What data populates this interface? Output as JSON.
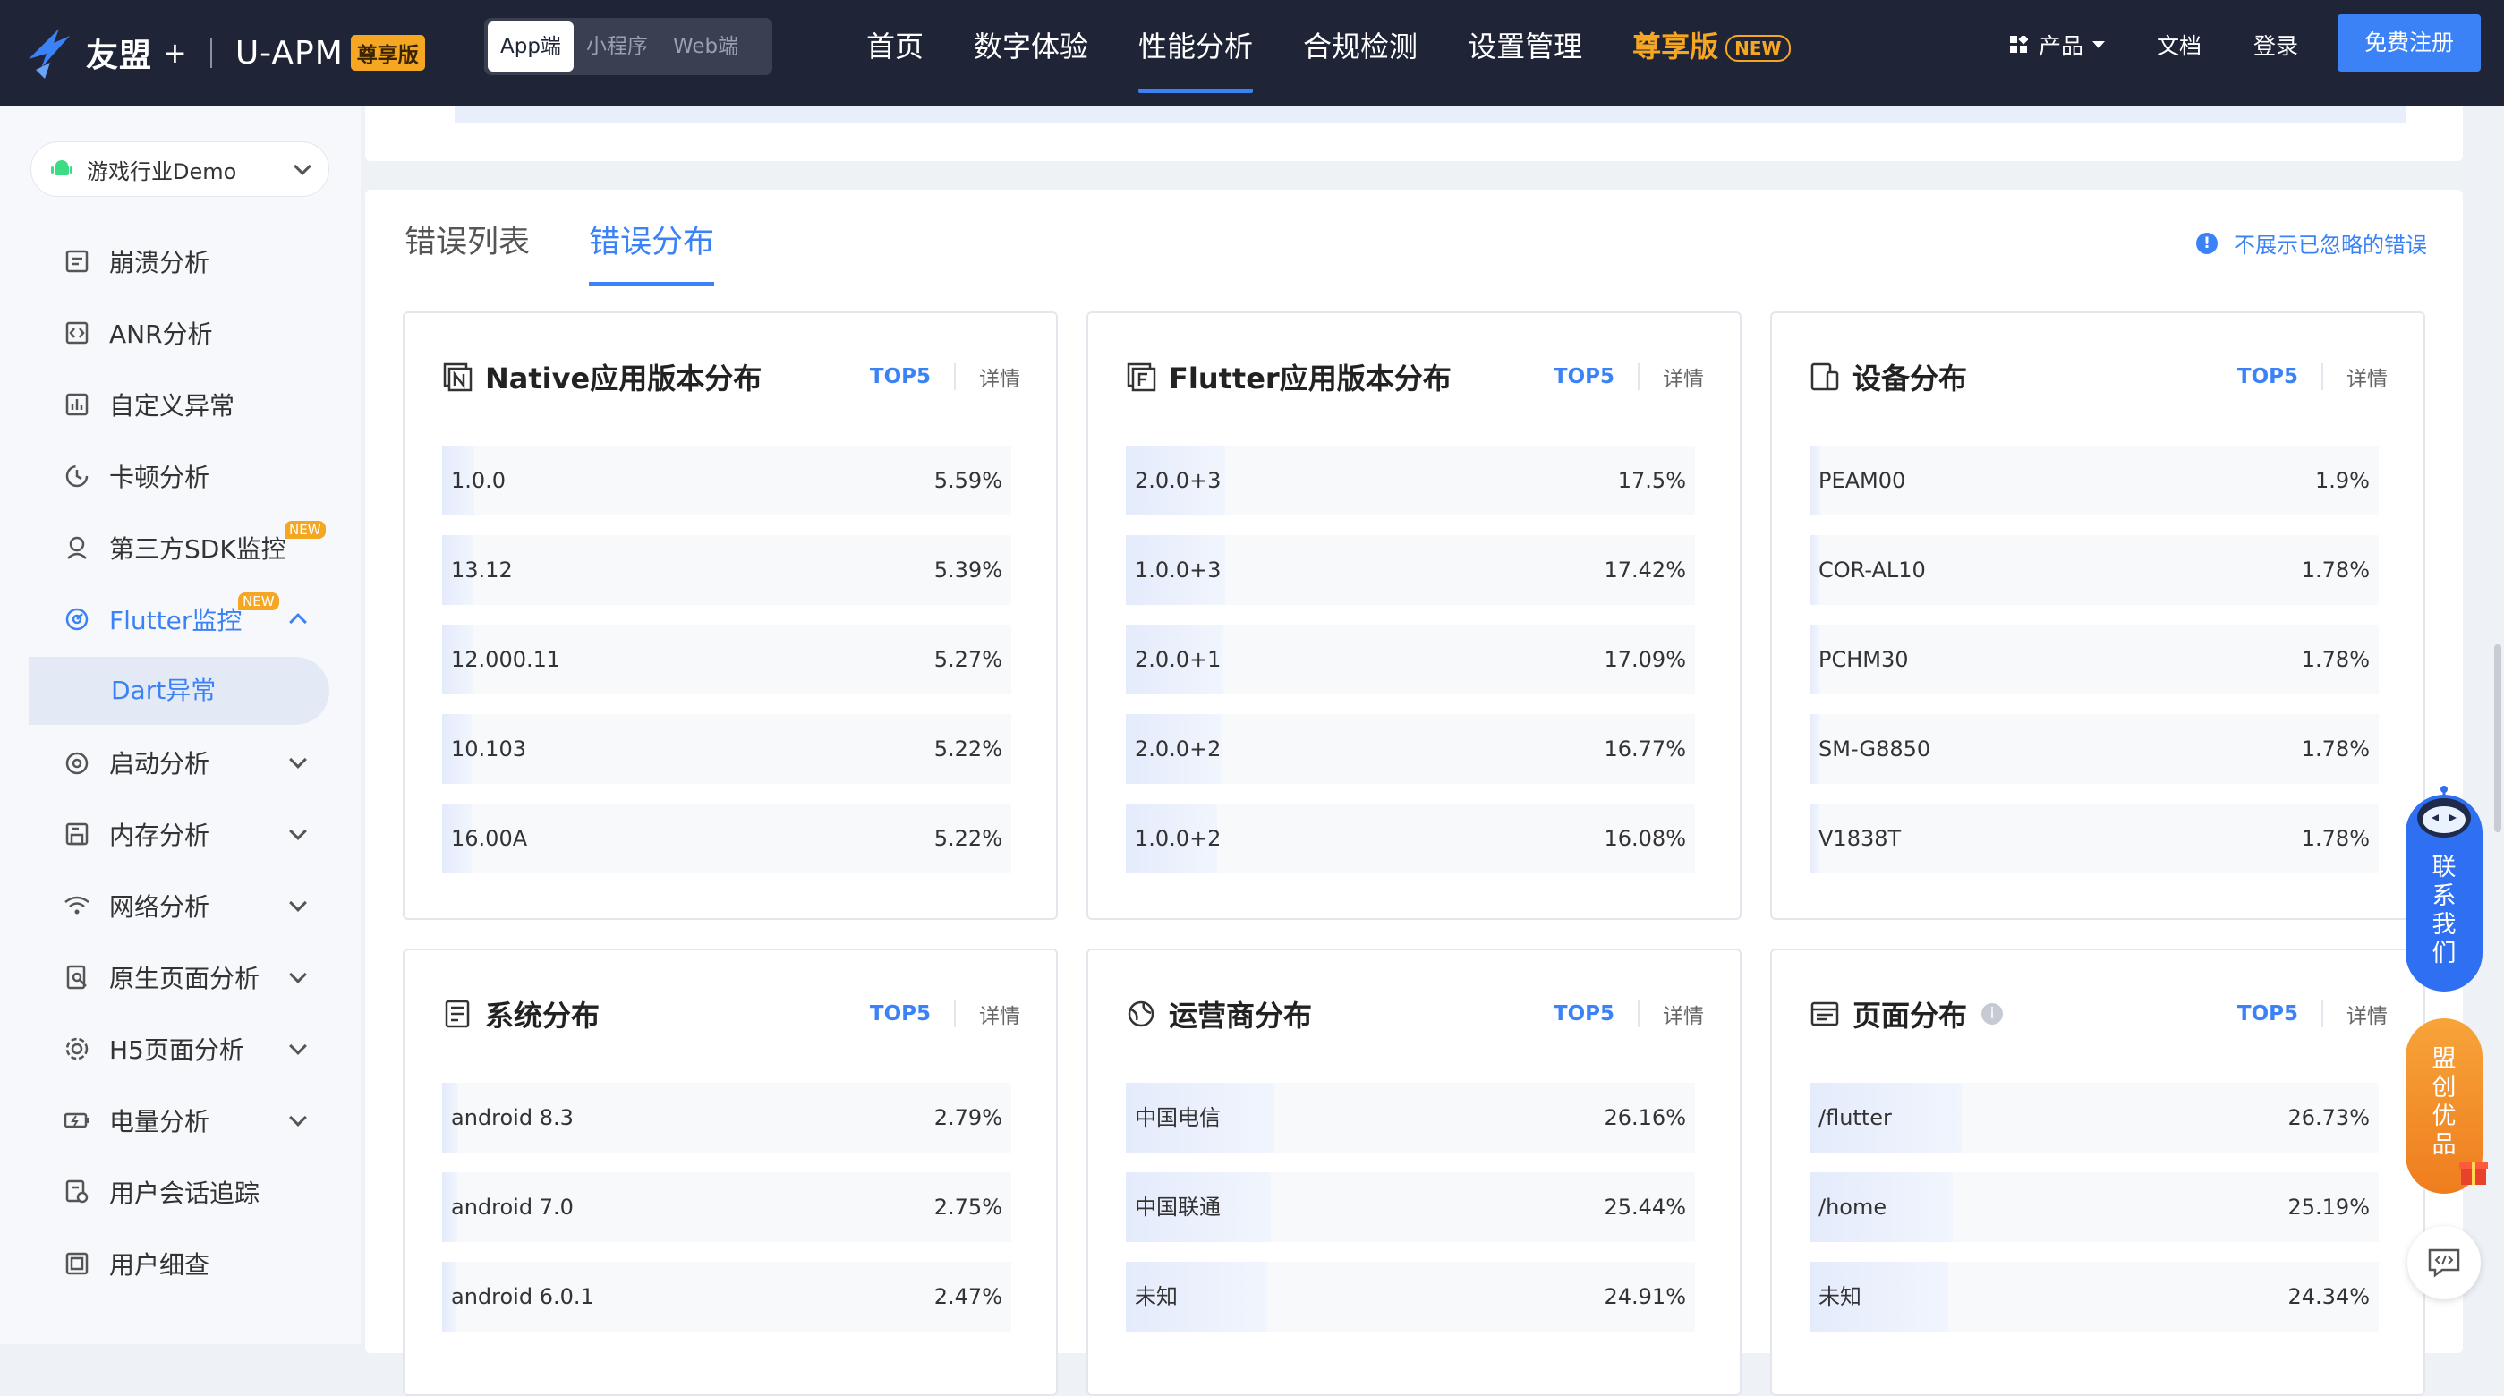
{
  "header": {
    "brand": "友盟",
    "brand_plus": "+",
    "product": "U-APM",
    "product_badge": "尊享版",
    "platforms": [
      "App端",
      "小程序",
      "Web端"
    ],
    "nav": [
      "首页",
      "数字体验",
      "性能分析",
      "合规检测",
      "设置管理"
    ],
    "vip_label": "尊享版",
    "vip_new": "NEW",
    "products": "产品",
    "docs": "文档",
    "login": "登录",
    "signup": "免费注册"
  },
  "sidebar": {
    "app_name": "游戏行业Demo",
    "items": [
      {
        "label": "崩溃分析"
      },
      {
        "label": "ANR分析"
      },
      {
        "label": "自定义异常"
      },
      {
        "label": "卡顿分析"
      },
      {
        "label": "第三方SDK监控",
        "badge": "NEW"
      },
      {
        "label": "Flutter监控",
        "badge": "NEW"
      },
      {
        "label": "启动分析"
      },
      {
        "label": "内存分析"
      },
      {
        "label": "网络分析"
      },
      {
        "label": "原生页面分析"
      },
      {
        "label": "H5页面分析"
      },
      {
        "label": "电量分析"
      },
      {
        "label": "用户会话追踪"
      },
      {
        "label": "用户细查"
      }
    ],
    "sub_item": "Dart异常"
  },
  "main": {
    "tabs": [
      "错误列表",
      "错误分布"
    ],
    "ignore_note": "不展示已忽略的错误",
    "top5": "TOP5",
    "detail": "详情",
    "panels": [
      {
        "title": "Native应用版本分布",
        "rows": [
          {
            "label": "1.0.0",
            "value": "5.59%"
          },
          {
            "label": "13.12",
            "value": "5.39%"
          },
          {
            "label": "12.000.11",
            "value": "5.27%"
          },
          {
            "label": "10.103",
            "value": "5.22%"
          },
          {
            "label": "16.00A",
            "value": "5.22%"
          }
        ]
      },
      {
        "title": "Flutter应用版本分布",
        "rows": [
          {
            "label": "2.0.0+3",
            "value": "17.5%"
          },
          {
            "label": "1.0.0+3",
            "value": "17.42%"
          },
          {
            "label": "2.0.0+1",
            "value": "17.09%"
          },
          {
            "label": "2.0.0+2",
            "value": "16.77%"
          },
          {
            "label": "1.0.0+2",
            "value": "16.08%"
          }
        ]
      },
      {
        "title": "设备分布",
        "rows": [
          {
            "label": "PEAM00",
            "value": "1.9%"
          },
          {
            "label": "COR-AL10",
            "value": "1.78%"
          },
          {
            "label": "PCHM30",
            "value": "1.78%"
          },
          {
            "label": "SM-G8850",
            "value": "1.78%"
          },
          {
            "label": "V1838T",
            "value": "1.78%"
          }
        ]
      },
      {
        "title": "系统分布",
        "rows": [
          {
            "label": "android 8.3",
            "value": "2.79%"
          },
          {
            "label": "android 7.0",
            "value": "2.75%"
          },
          {
            "label": "android 6.0.1",
            "value": "2.47%"
          }
        ]
      },
      {
        "title": "运营商分布",
        "rows": [
          {
            "label": "中国电信",
            "value": "26.16%"
          },
          {
            "label": "中国联通",
            "value": "25.44%"
          },
          {
            "label": "未知",
            "value": "24.91%"
          }
        ]
      },
      {
        "title": "页面分布",
        "rows": [
          {
            "label": "/flutter",
            "value": "26.73%"
          },
          {
            "label": "/home",
            "value": "25.19%"
          },
          {
            "label": "未知",
            "value": "24.34%"
          }
        ]
      }
    ]
  },
  "floating": {
    "contact": "联系我们",
    "union": "盟创优品"
  },
  "colors": {
    "topbar": "#1f2437",
    "accent": "#3b82f6",
    "vip": "#f5a623",
    "bar_fill": "#e4ebfb"
  }
}
